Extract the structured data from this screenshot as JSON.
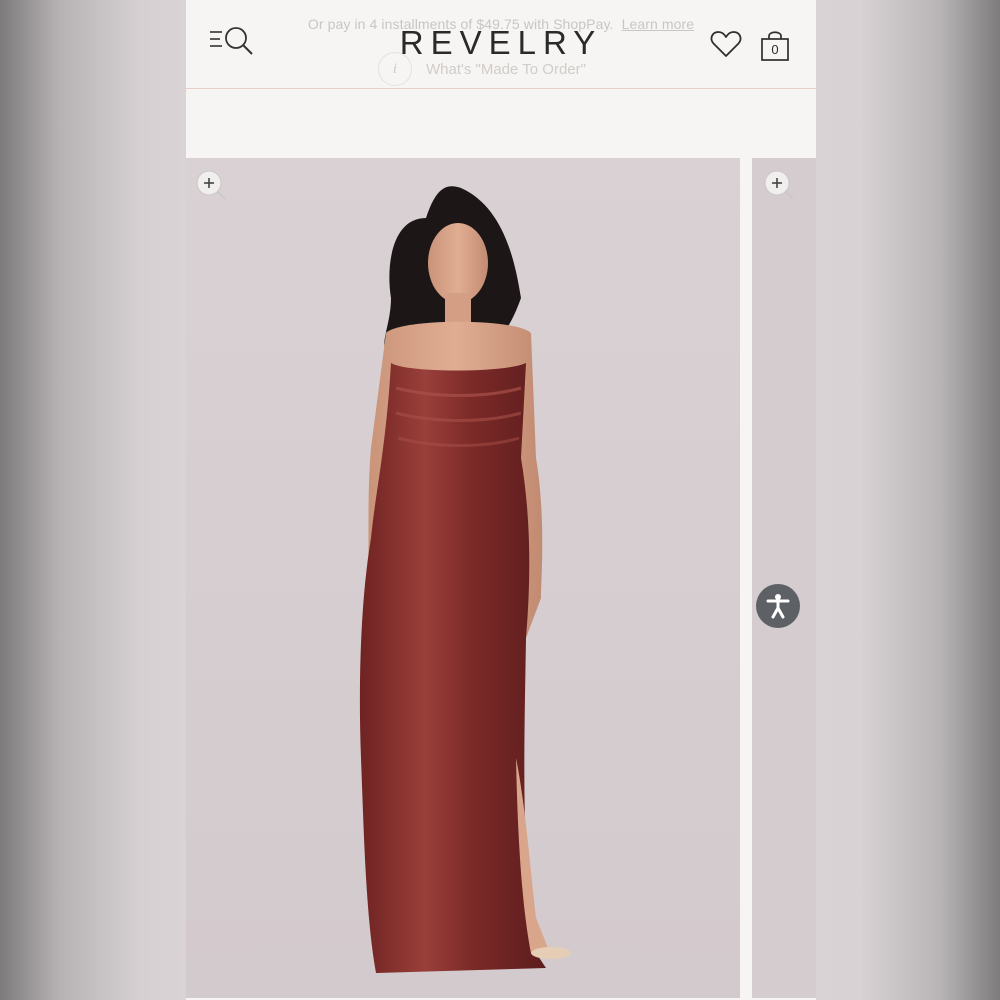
{
  "header": {
    "promo_text": "Or pay in 4 installments of $49.75 with ShopPay.",
    "promo_link": "Learn more",
    "brand": "REVELRY",
    "info_icon_glyph": "i",
    "made_to_order": "What's \"Made To Order\"",
    "bag_count": "0",
    "icons": [
      "menu-search-icon",
      "heart-icon",
      "shopping-bag-icon"
    ]
  },
  "gallery": {
    "slides": [
      {
        "kind": "product-photo",
        "subject": "model wearing rust velvet cowl-neck maxi dress"
      },
      {
        "kind": "product-photo-peek"
      }
    ],
    "zoom_glyph": "+",
    "accessibility_icon": "accessibility-person-icon"
  },
  "colors": {
    "page_bg": "#f7f5f3",
    "photo_bg": "#d7cfd1",
    "dress": "#7f2a28",
    "header_rule": "#e6cfc5",
    "a11y_button": "#5d6166"
  }
}
